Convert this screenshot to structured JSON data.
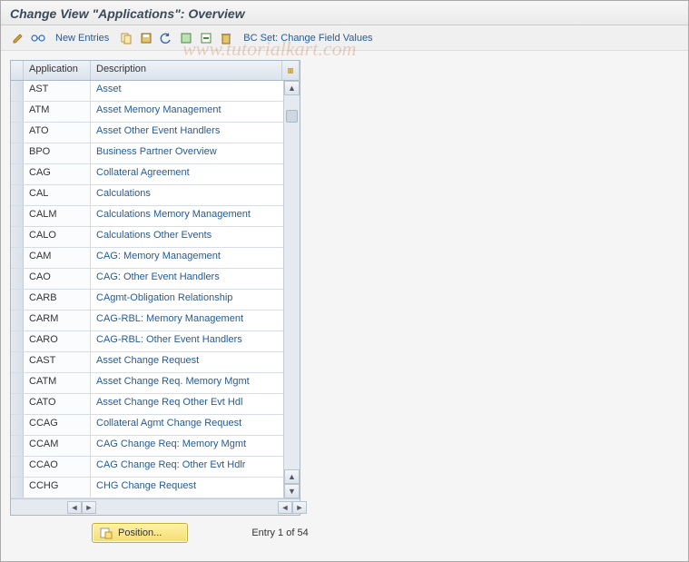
{
  "header": {
    "title": "Change View \"Applications\": Overview"
  },
  "toolbar": {
    "new_entries_label": "New Entries",
    "bcset_label": "BC Set: Change Field Values"
  },
  "table": {
    "columns": {
      "application": "Application",
      "description": "Description"
    },
    "rows": [
      {
        "app": "AST",
        "desc": "Asset"
      },
      {
        "app": "ATM",
        "desc": "Asset Memory Management"
      },
      {
        "app": "ATO",
        "desc": "Asset Other Event Handlers"
      },
      {
        "app": "BPO",
        "desc": "Business Partner Overview"
      },
      {
        "app": "CAG",
        "desc": "Collateral Agreement"
      },
      {
        "app": "CAL",
        "desc": "Calculations"
      },
      {
        "app": "CALM",
        "desc": "Calculations Memory Management"
      },
      {
        "app": "CALO",
        "desc": "Calculations Other Events"
      },
      {
        "app": "CAM",
        "desc": "CAG: Memory Management"
      },
      {
        "app": "CAO",
        "desc": "CAG: Other Event Handlers"
      },
      {
        "app": "CARB",
        "desc": "CAgmt-Obligation Relationship"
      },
      {
        "app": "CARM",
        "desc": "CAG-RBL: Memory Management"
      },
      {
        "app": "CARO",
        "desc": "CAG-RBL: Other Event Handlers"
      },
      {
        "app": "CAST",
        "desc": "Asset Change Request"
      },
      {
        "app": "CATM",
        "desc": "Asset Change Req. Memory Mgmt"
      },
      {
        "app": "CATO",
        "desc": "Asset Change Req Other Evt Hdl"
      },
      {
        "app": "CCAG",
        "desc": "Collateral Agmt Change Request"
      },
      {
        "app": "CCAM",
        "desc": "CAG Change Req: Memory Mgmt"
      },
      {
        "app": "CCAO",
        "desc": "CAG Change Req: Other Evt Hdlr"
      },
      {
        "app": "CCHG",
        "desc": "CHG Change Request"
      }
    ]
  },
  "footer": {
    "position_label": "Position...",
    "entry_text": "Entry 1 of 54"
  },
  "watermark": "www.tutorialkart.com"
}
